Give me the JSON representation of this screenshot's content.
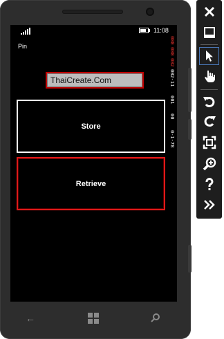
{
  "phone": {
    "status_bar": {
      "time": "11:08"
    },
    "page_title": "Pin",
    "textbox": {
      "value": "ThaiCreate.Com"
    },
    "buttons": {
      "store_label": "Store",
      "retrieve_label": "Retrieve"
    },
    "debug_counters": [
      {
        "text": "000",
        "color": "red"
      },
      {
        "text": "000",
        "color": "red"
      },
      {
        "text": "002",
        "color": "red"
      },
      {
        "text": "002-11",
        "color": "white"
      },
      {
        "text": "001",
        "color": "white"
      },
      {
        "text": "00",
        "color": "white"
      },
      {
        "text": "0-1-78",
        "color": "white"
      }
    ],
    "navbar": {
      "back": "back-arrow-icon",
      "start": "windows-logo-icon",
      "search": "search-icon"
    }
  },
  "emulator_toolbar": {
    "items": [
      {
        "name": "close-icon",
        "glyph": "✕"
      },
      {
        "name": "minimize-icon",
        "glyph": ""
      },
      {
        "name": "pointer-icon",
        "glyph": "",
        "active": true
      },
      {
        "name": "touch-hand-icon",
        "glyph": ""
      },
      {
        "name": "rotate-left-icon",
        "glyph": "↶"
      },
      {
        "name": "rotate-right-icon",
        "glyph": "↷"
      },
      {
        "name": "fit-to-screen-icon",
        "glyph": ""
      },
      {
        "name": "zoom-icon",
        "glyph": ""
      },
      {
        "name": "help-icon",
        "glyph": "?"
      },
      {
        "name": "additional-tools-icon",
        "glyph": "»"
      }
    ]
  },
  "colors": {
    "accent_red": "#e11919",
    "screen_bg": "#000000",
    "frame": "#2d2d2d"
  }
}
